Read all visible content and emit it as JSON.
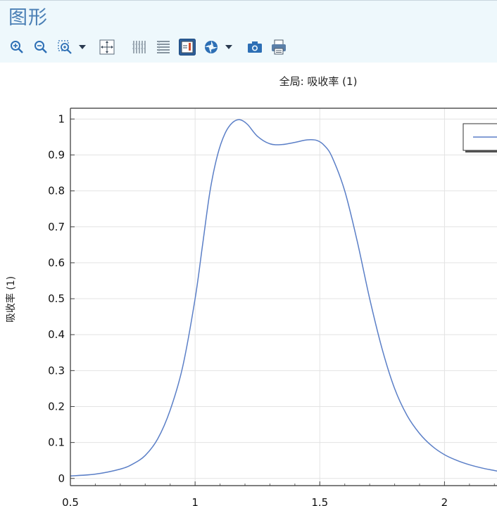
{
  "panel": {
    "title": "图形"
  },
  "toolbar": {
    "buttons": [
      {
        "name": "zoom-in-icon"
      },
      {
        "name": "zoom-out-icon"
      },
      {
        "name": "zoom-box-icon"
      },
      {
        "name": "dropdown-arrow-icon"
      },
      {
        "name": "zoom-extents-icon"
      },
      {
        "name": "grid-icon"
      },
      {
        "name": "table-icon"
      },
      {
        "name": "legend-toggle-icon"
      },
      {
        "name": "color-icon"
      },
      {
        "name": "dropdown-arrow-icon"
      },
      {
        "name": "camera-icon"
      },
      {
        "name": "print-icon"
      }
    ]
  },
  "chart_data": {
    "type": "line",
    "title": "全局: 吸收率 (1)",
    "xlabel": "",
    "ylabel": "吸收率 (1)",
    "xlim": [
      0.5,
      2.25
    ],
    "ylim": [
      -0.02,
      1.03
    ],
    "grid": true,
    "legend_position": "top-right",
    "x_ticks": [
      "0.5",
      "1",
      "1.5",
      "2"
    ],
    "y_ticks": [
      "0",
      "0.1",
      "0.2",
      "0.3",
      "0.4",
      "0.5",
      "0.6",
      "0.7",
      "0.8",
      "0.9",
      "1"
    ],
    "series": [
      {
        "color": "#5b7fc7",
        "x": [
          0.5,
          0.6,
          0.7,
          0.75,
          0.8,
          0.85,
          0.9,
          0.95,
          1.0,
          1.03,
          1.06,
          1.09,
          1.12,
          1.15,
          1.18,
          1.21,
          1.25,
          1.3,
          1.35,
          1.4,
          1.45,
          1.49,
          1.52,
          1.55,
          1.6,
          1.65,
          1.7,
          1.75,
          1.8,
          1.85,
          1.9,
          1.95,
          2.0,
          2.05,
          2.1,
          2.15,
          2.2,
          2.25
        ],
        "values": [
          0.007,
          0.012,
          0.026,
          0.04,
          0.064,
          0.11,
          0.19,
          0.31,
          0.5,
          0.65,
          0.8,
          0.9,
          0.96,
          0.99,
          0.998,
          0.985,
          0.952,
          0.931,
          0.929,
          0.935,
          0.942,
          0.94,
          0.925,
          0.893,
          0.8,
          0.66,
          0.5,
          0.36,
          0.25,
          0.175,
          0.125,
          0.09,
          0.066,
          0.05,
          0.038,
          0.029,
          0.022,
          0.015
        ]
      }
    ]
  }
}
